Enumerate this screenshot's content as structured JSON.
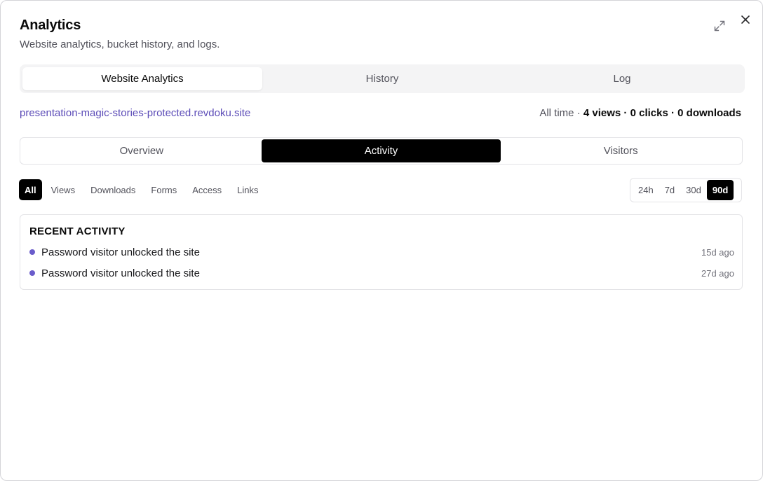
{
  "dialog": {
    "title": "Analytics",
    "subtitle": "Website analytics, bucket history, and logs.",
    "expand_icon": "expand-icon",
    "close_icon": "close-icon"
  },
  "main_tabs": [
    {
      "label": "Website Analytics",
      "active": true
    },
    {
      "label": "History",
      "active": false
    },
    {
      "label": "Log",
      "active": false
    }
  ],
  "site": {
    "url": "presentation-magic-stories-protected.revdoku.site"
  },
  "stats": {
    "period": "All time",
    "views": "4 views",
    "clicks": "0 clicks",
    "downloads": "0 downloads",
    "separator": " · "
  },
  "sub_tabs": [
    {
      "label": "Overview",
      "active": false
    },
    {
      "label": "Activity",
      "active": true
    },
    {
      "label": "Visitors",
      "active": false
    }
  ],
  "filters": [
    {
      "label": "All",
      "active": true
    },
    {
      "label": "Views",
      "active": false
    },
    {
      "label": "Downloads",
      "active": false
    },
    {
      "label": "Forms",
      "active": false
    },
    {
      "label": "Access",
      "active": false
    },
    {
      "label": "Links",
      "active": false
    }
  ],
  "ranges": [
    {
      "label": "24h",
      "active": false
    },
    {
      "label": "7d",
      "active": false
    },
    {
      "label": "30d",
      "active": false
    },
    {
      "label": "90d",
      "active": true
    }
  ],
  "activity": {
    "title": "RECENT ACTIVITY",
    "items": [
      {
        "text": "Password visitor unlocked the site",
        "time": "15d ago"
      },
      {
        "text": "Password visitor unlocked the site",
        "time": "27d ago"
      }
    ]
  },
  "colors": {
    "accent": "#5b4bb7",
    "dot": "#6a5ccb",
    "active_bg": "#000000"
  }
}
